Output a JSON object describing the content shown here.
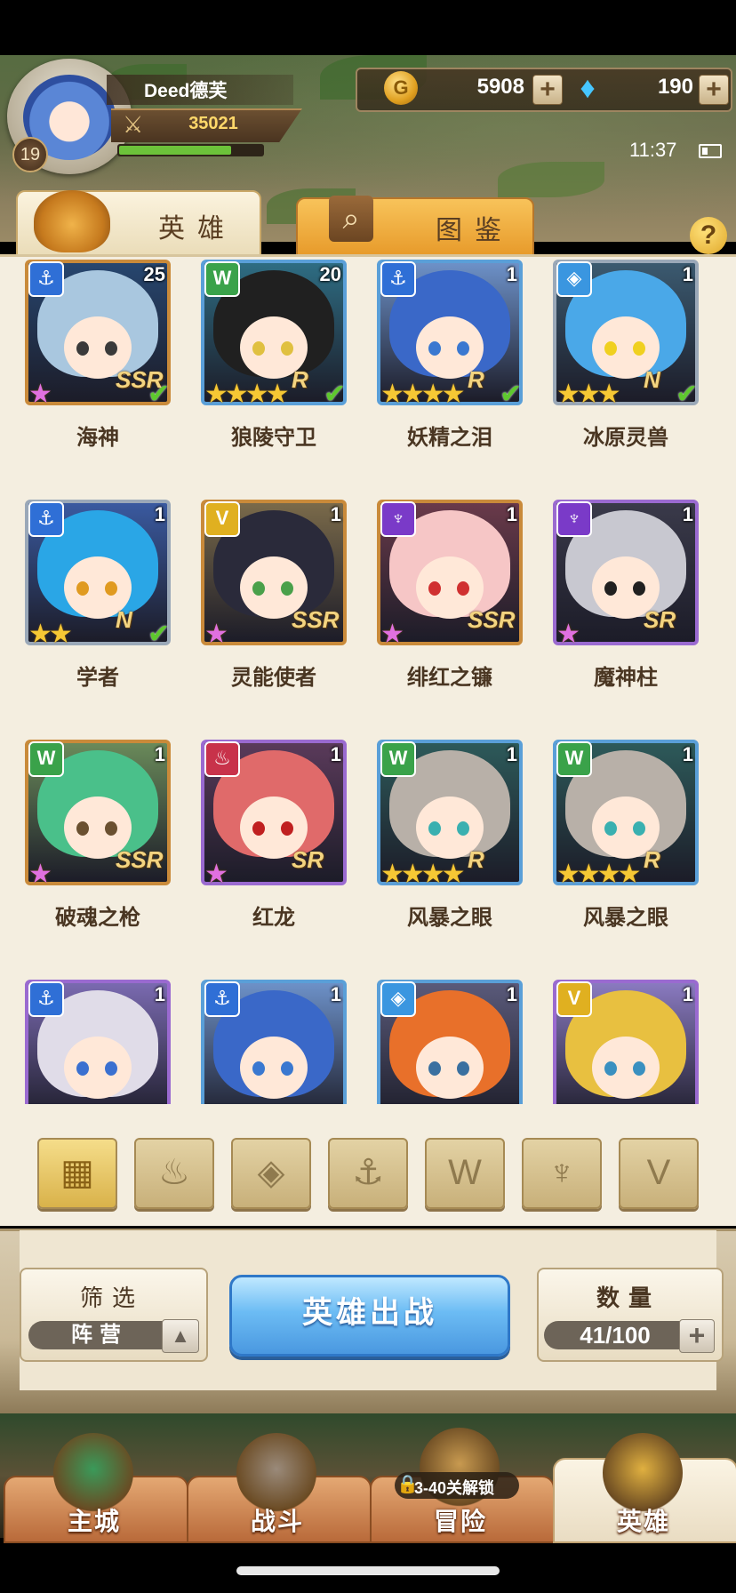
{
  "player": {
    "name": "Deed德芙",
    "level": "19",
    "power": "35021",
    "exp_fraction": 0.78
  },
  "resources": {
    "gold": "5908",
    "gems": "190",
    "gold_icon": "G"
  },
  "status": {
    "time": "11:37"
  },
  "tabs": {
    "hero": "英雄",
    "catalog": "图鉴",
    "help": "?"
  },
  "heroes": [
    {
      "name": "海神",
      "level": "25",
      "faction": "anchor",
      "stars": 1,
      "rainbow": true,
      "rarity": "SSR",
      "checked": true,
      "frame": "#c98a3a",
      "hair": "#a9c7df",
      "bg": "#27466f",
      "eye": "#3a3a3a"
    },
    {
      "name": "狼陵守卫",
      "level": "20",
      "faction": "wolf",
      "stars": 4,
      "rainbow": false,
      "rarity": "R",
      "checked": true,
      "frame": "#5a9fd8",
      "hair": "#202020",
      "bg": "#2e6d83",
      "eye": "#e0c040"
    },
    {
      "name": "妖精之泪",
      "level": "1",
      "faction": "anchor",
      "stars": 4,
      "rainbow": false,
      "rarity": "R",
      "checked": true,
      "frame": "#5a9fd8",
      "hair": "#3a68c8",
      "bg": "#6d91c8",
      "eye": "#3a78d0"
    },
    {
      "name": "冰原灵兽",
      "level": "1",
      "faction": "diamond",
      "stars": 3,
      "rainbow": false,
      "rarity": "N",
      "checked": true,
      "frame": "#9aa8b8",
      "hair": "#4aa8e8",
      "bg": "#3b5a70",
      "eye": "#f0d020"
    },
    {
      "name": "学者",
      "level": "1",
      "faction": "anchor",
      "stars": 2,
      "rainbow": false,
      "rarity": "N",
      "checked": true,
      "frame": "#9aa8b8",
      "hair": "#2aa6e6",
      "bg": "#3a5aa0",
      "eye": "#e09a20"
    },
    {
      "name": "灵能使者",
      "level": "1",
      "faction": "chevron",
      "stars": 1,
      "rainbow": true,
      "rarity": "SSR",
      "checked": false,
      "frame": "#c98a3a",
      "hair": "#2a2a3a",
      "bg": "#7a6a4a",
      "eye": "#4aa04a"
    },
    {
      "name": "绯红之镰",
      "level": "1",
      "faction": "demon",
      "stars": 1,
      "rainbow": true,
      "rarity": "SSR",
      "checked": false,
      "frame": "#c98a3a",
      "hair": "#f6c6c6",
      "bg": "#6a3a4a",
      "eye": "#d03030"
    },
    {
      "name": "魔神柱",
      "level": "1",
      "faction": "demon",
      "stars": 1,
      "rainbow": true,
      "rarity": "SR",
      "checked": false,
      "frame": "#9a6ad0",
      "hair": "#c8c8d0",
      "bg": "#3a3a4a",
      "eye": "#202020"
    },
    {
      "name": "破魂之枪",
      "level": "1",
      "faction": "wolf",
      "stars": 1,
      "rainbow": true,
      "rarity": "SSR",
      "checked": false,
      "frame": "#c98a3a",
      "hair": "#4ac08a",
      "bg": "#6a8a5a",
      "eye": "#6a5030"
    },
    {
      "name": "红龙",
      "level": "1",
      "faction": "fire",
      "stars": 1,
      "rainbow": true,
      "rarity": "SR",
      "checked": false,
      "frame": "#9a6ad0",
      "hair": "#e06a6a",
      "bg": "#5a3a5a",
      "eye": "#c02020"
    },
    {
      "name": "风暴之眼",
      "level": "1",
      "faction": "wolf",
      "stars": 4,
      "rainbow": false,
      "rarity": "R",
      "checked": false,
      "frame": "#5a9fd8",
      "hair": "#b8b0a8",
      "bg": "#2d5a5a",
      "eye": "#3ab0b0"
    },
    {
      "name": "风暴之眼",
      "level": "1",
      "faction": "wolf",
      "stars": 4,
      "rainbow": false,
      "rarity": "R",
      "checked": false,
      "frame": "#5a9fd8",
      "hair": "#b8b0a8",
      "bg": "#2d5a5a",
      "eye": "#3ab0b0"
    },
    {
      "name": "",
      "level": "1",
      "faction": "anchor",
      "stars": 0,
      "rainbow": false,
      "rarity": "",
      "checked": false,
      "frame": "#9a6ad0",
      "hair": "#e0dce8",
      "bg": "#7a6ab0",
      "eye": "#3a70d0"
    },
    {
      "name": "",
      "level": "1",
      "faction": "anchor",
      "stars": 0,
      "rainbow": false,
      "rarity": "",
      "checked": false,
      "frame": "#5a9fd8",
      "hair": "#3a68c8",
      "bg": "#6d91c8",
      "eye": "#3a78d0"
    },
    {
      "name": "",
      "level": "1",
      "faction": "diamond",
      "stars": 0,
      "rainbow": false,
      "rarity": "",
      "checked": false,
      "frame": "#5a9fd8",
      "hair": "#e8702a",
      "bg": "#5a5a7a",
      "eye": "#3a70a0"
    },
    {
      "name": "",
      "level": "1",
      "faction": "chevron",
      "stars": 0,
      "rainbow": false,
      "rarity": "",
      "checked": false,
      "frame": "#9a6ad0",
      "hair": "#e8c040",
      "bg": "#8a7ac0",
      "eye": "#3a90c0"
    }
  ],
  "factions": {
    "anchor": {
      "glyph": "⚓",
      "color": "#2f6fd6"
    },
    "wolf": {
      "glyph": "W",
      "color": "#3aa24a"
    },
    "diamond": {
      "glyph": "◈",
      "color": "#3a96e0"
    },
    "chevron": {
      "glyph": "V",
      "color": "#e0b020"
    },
    "demon": {
      "glyph": "♆",
      "color": "#7a3ac8"
    },
    "fire": {
      "glyph": "♨",
      "color": "#c8324a"
    }
  },
  "filter_icons": [
    {
      "name": "filter-all-icon",
      "glyph": "▦"
    },
    {
      "name": "filter-fire-icon",
      "glyph": "♨"
    },
    {
      "name": "filter-diamond-icon",
      "glyph": "◈"
    },
    {
      "name": "filter-anchor-icon",
      "glyph": "⚓"
    },
    {
      "name": "filter-wolf-icon",
      "glyph": "W"
    },
    {
      "name": "filter-demon-icon",
      "glyph": "♆"
    },
    {
      "name": "filter-chevron-icon",
      "glyph": "V"
    }
  ],
  "controls": {
    "filter_label": "筛选",
    "filter_value": "阵营",
    "filter_toggle": "▲",
    "deploy": "英雄出战",
    "count_label": "数量",
    "count_value": "41/100",
    "count_add": "+"
  },
  "nav": [
    {
      "label": "主城",
      "icon": "castle-icon"
    },
    {
      "label": "战斗",
      "icon": "crossed-swords-icon"
    },
    {
      "label": "冒险",
      "icon": "adventure-map-icon"
    },
    {
      "label": "英雄",
      "icon": "hero-crest-icon"
    }
  ],
  "nav_lock": {
    "text": "3-40关解锁",
    "icon": "🔒"
  }
}
